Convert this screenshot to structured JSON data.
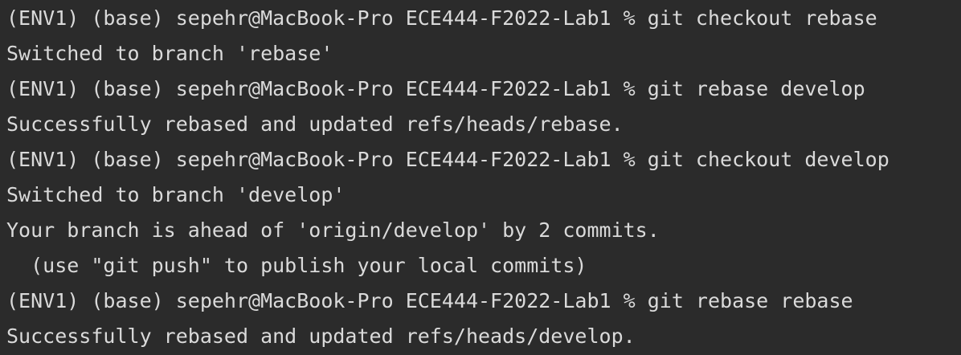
{
  "terminal": {
    "lines": [
      "(ENV1) (base) sepehr@MacBook-Pro ECE444-F2022-Lab1 % git checkout rebase",
      "Switched to branch 'rebase'",
      "(ENV1) (base) sepehr@MacBook-Pro ECE444-F2022-Lab1 % git rebase develop",
      "Successfully rebased and updated refs/heads/rebase.",
      "(ENV1) (base) sepehr@MacBook-Pro ECE444-F2022-Lab1 % git checkout develop",
      "Switched to branch 'develop'",
      "Your branch is ahead of 'origin/develop' by 2 commits.",
      "  (use \"git push\" to publish your local commits)",
      "(ENV1) (base) sepehr@MacBook-Pro ECE444-F2022-Lab1 % git rebase rebase",
      "Successfully rebased and updated refs/heads/develop."
    ]
  },
  "colors": {
    "background": "#2b2b2b",
    "text": "#dadada"
  }
}
